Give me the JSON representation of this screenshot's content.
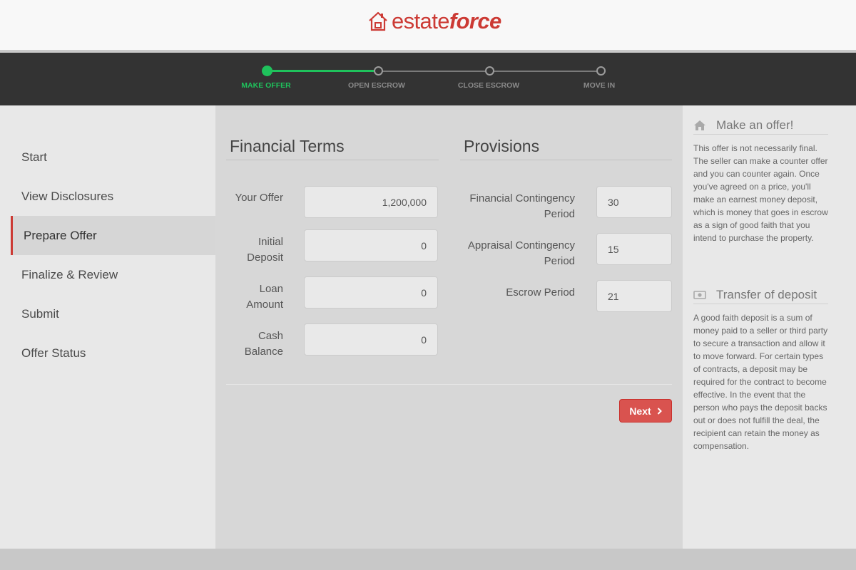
{
  "brand": {
    "prefix": "estate",
    "suffix": "force",
    "color": "#cc3a34"
  },
  "progress": {
    "steps": [
      {
        "label": "MAKE OFFER",
        "state": "active"
      },
      {
        "label": "OPEN ESCROW",
        "state": "todo"
      },
      {
        "label": "CLOSE ESCROW",
        "state": "todo"
      },
      {
        "label": "MOVE IN",
        "state": "todo"
      }
    ],
    "active_color": "#1fc25c"
  },
  "nav": {
    "items": [
      {
        "label": "Start"
      },
      {
        "label": "View Disclosures"
      },
      {
        "label": "Prepare Offer",
        "active": true
      },
      {
        "label": "Finalize & Review"
      },
      {
        "label": "Submit"
      },
      {
        "label": "Offer Status"
      }
    ]
  },
  "financial": {
    "title": "Financial Terms",
    "fields": [
      {
        "label": "Your Offer",
        "value": "1,200,000"
      },
      {
        "label": "Initial Deposit",
        "value": "0"
      },
      {
        "label": "Loan Amount",
        "value": "0"
      },
      {
        "label": "Cash Balance",
        "value": "0"
      }
    ]
  },
  "provisions": {
    "title": "Provisions",
    "fields": [
      {
        "label": "Financial Contingency Period",
        "value": "30"
      },
      {
        "label": "Appraisal Contingency Period",
        "value": "15"
      },
      {
        "label": "Escrow Period",
        "value": "21"
      }
    ]
  },
  "actions": {
    "next_label": "Next",
    "next_color": "#d9534f"
  },
  "help": {
    "sections": [
      {
        "icon": "home-icon",
        "title": "Make an offer!",
        "text": "This offer is not necessarily final. The seller can make a counter offer and you can counter again. Once you've agreed on a price, you'll make an earnest money deposit, which is money that goes in escrow as a sign of good faith that you intend to purchase the property."
      },
      {
        "icon": "money-icon",
        "title": "Transfer of deposit",
        "text": "A good faith deposit is a sum of money paid to a seller or third party to secure a transaction and allow it to move forward. For certain types of contracts, a deposit may be required for the contract to become effective. In the event that the person who pays the deposit backs out or does not fulfill the deal, the recipient can retain the money as compensation."
      }
    ]
  }
}
